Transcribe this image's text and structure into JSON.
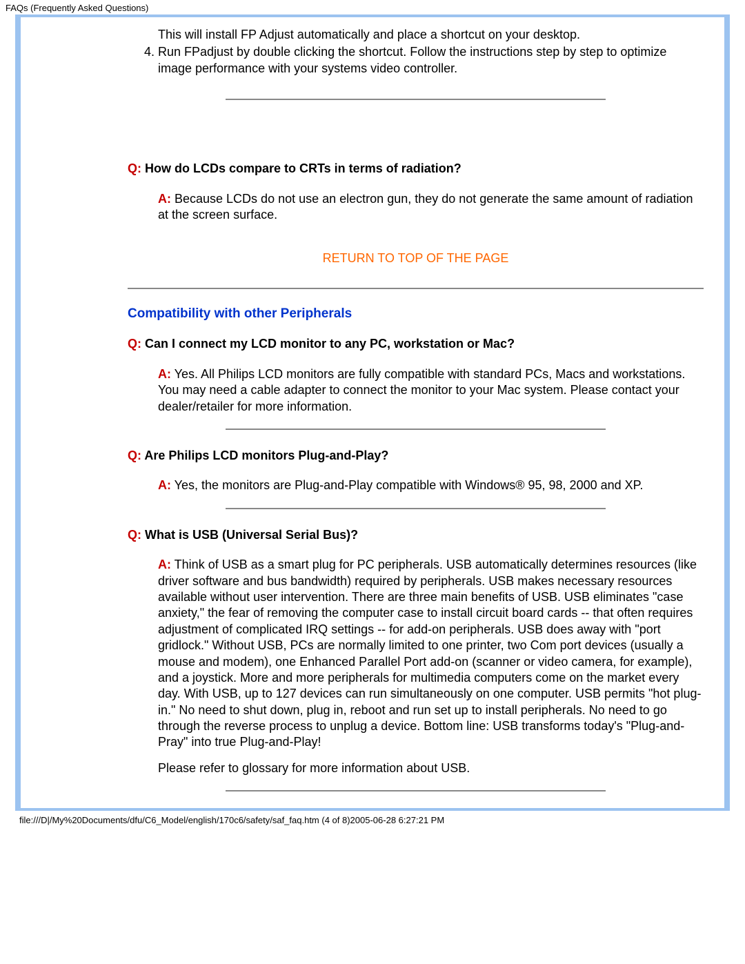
{
  "header": "FAQs (Frequently Asked Questions)",
  "steps": {
    "s2_cont": "This will install FP Adjust automatically and place a shortcut on your desktop.",
    "s3": "Run FPadjust by double clicking the shortcut. Follow the instructions step by step to optimize image performance with your systems video controller."
  },
  "q_label": "Q:",
  "a_label": "A:",
  "q_radiation": " How do LCDs compare to CRTs in terms of radiation?",
  "a_radiation": " Because LCDs do not use an electron gun, they do not generate the same amount of radiation at the screen surface.",
  "return_top": "RETURN TO TOP OF THE PAGE",
  "section_compat": "Compatibility with other Peripherals",
  "q_connect": " Can I connect my LCD monitor to any PC, workstation or Mac?",
  "a_connect": " Yes. All Philips LCD monitors are fully compatible with standard PCs, Macs and workstations. You may need a cable adapter to connect the monitor to your Mac system. Please contact your dealer/retailer for more information.",
  "q_pnp": " Are Philips LCD monitors Plug-and-Play?",
  "a_pnp": " Yes, the monitors are Plug-and-Play compatible with Windows® 95, 98, 2000 and XP.",
  "q_usb": " What is USB (Universal Serial Bus)?",
  "a_usb": " Think of USB as a smart plug for PC peripherals. USB automatically determines resources (like driver software and bus bandwidth) required by peripherals. USB makes necessary resources available without user intervention. There are three main benefits of USB. USB eliminates \"case anxiety,\" the fear of removing the computer case to install circuit board cards -- that often requires adjustment of complicated IRQ settings -- for add-on peripherals. USB does away with \"port gridlock.\" Without USB, PCs are normally limited to one printer, two Com port devices (usually a mouse and modem), one Enhanced Parallel Port add-on (scanner or video camera, for example), and a joystick. More and more peripherals for multimedia computers come on the market every day. With USB, up to 127 devices can run simultaneously on one computer. USB permits \"hot plug-in.\" No need to shut down, plug in, reboot and run set up to install peripherals. No need to go through the reverse process to unplug a device. Bottom line: USB transforms today's \"Plug-and-Pray\" into true Plug-and-Play!",
  "a_usb_p2": "Please refer to glossary for more information about USB.",
  "footer": "file:///D|/My%20Documents/dfu/C6_Model/english/170c6/safety/saf_faq.htm (4 of 8)2005-06-28 6:27:21 PM"
}
